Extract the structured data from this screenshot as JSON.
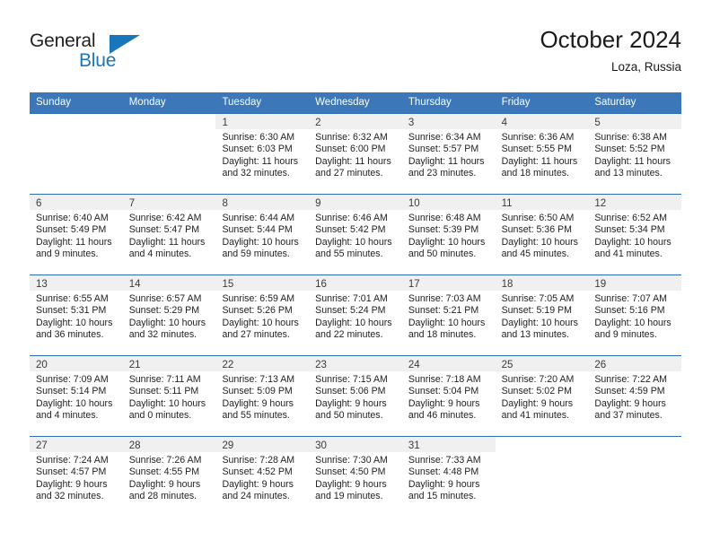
{
  "brand": {
    "name_top": "General",
    "name_bottom": "Blue",
    "accent_color": "#1b75bb",
    "mark": "triangle-icon"
  },
  "header": {
    "title": "October 2024",
    "subtitle": "Loza, Russia"
  },
  "theme": {
    "header_blue": "#3b77b9",
    "row_border_blue": "#2f6daf",
    "daynum_strip": "#f0f0f0"
  },
  "calendar": {
    "weekdays": [
      "Sunday",
      "Monday",
      "Tuesday",
      "Wednesday",
      "Thursday",
      "Friday",
      "Saturday"
    ],
    "weeks": [
      [
        {
          "day": "",
          "sunrise": "",
          "sunset": "",
          "daylight_1": "",
          "daylight_2": ""
        },
        {
          "day": "",
          "sunrise": "",
          "sunset": "",
          "daylight_1": "",
          "daylight_2": ""
        },
        {
          "day": "1",
          "sunrise": "Sunrise: 6:30 AM",
          "sunset": "Sunset: 6:03 PM",
          "daylight_1": "Daylight: 11 hours",
          "daylight_2": "and 32 minutes."
        },
        {
          "day": "2",
          "sunrise": "Sunrise: 6:32 AM",
          "sunset": "Sunset: 6:00 PM",
          "daylight_1": "Daylight: 11 hours",
          "daylight_2": "and 27 minutes."
        },
        {
          "day": "3",
          "sunrise": "Sunrise: 6:34 AM",
          "sunset": "Sunset: 5:57 PM",
          "daylight_1": "Daylight: 11 hours",
          "daylight_2": "and 23 minutes."
        },
        {
          "day": "4",
          "sunrise": "Sunrise: 6:36 AM",
          "sunset": "Sunset: 5:55 PM",
          "daylight_1": "Daylight: 11 hours",
          "daylight_2": "and 18 minutes."
        },
        {
          "day": "5",
          "sunrise": "Sunrise: 6:38 AM",
          "sunset": "Sunset: 5:52 PM",
          "daylight_1": "Daylight: 11 hours",
          "daylight_2": "and 13 minutes."
        }
      ],
      [
        {
          "day": "6",
          "sunrise": "Sunrise: 6:40 AM",
          "sunset": "Sunset: 5:49 PM",
          "daylight_1": "Daylight: 11 hours",
          "daylight_2": "and 9 minutes."
        },
        {
          "day": "7",
          "sunrise": "Sunrise: 6:42 AM",
          "sunset": "Sunset: 5:47 PM",
          "daylight_1": "Daylight: 11 hours",
          "daylight_2": "and 4 minutes."
        },
        {
          "day": "8",
          "sunrise": "Sunrise: 6:44 AM",
          "sunset": "Sunset: 5:44 PM",
          "daylight_1": "Daylight: 10 hours",
          "daylight_2": "and 59 minutes."
        },
        {
          "day": "9",
          "sunrise": "Sunrise: 6:46 AM",
          "sunset": "Sunset: 5:42 PM",
          "daylight_1": "Daylight: 10 hours",
          "daylight_2": "and 55 minutes."
        },
        {
          "day": "10",
          "sunrise": "Sunrise: 6:48 AM",
          "sunset": "Sunset: 5:39 PM",
          "daylight_1": "Daylight: 10 hours",
          "daylight_2": "and 50 minutes."
        },
        {
          "day": "11",
          "sunrise": "Sunrise: 6:50 AM",
          "sunset": "Sunset: 5:36 PM",
          "daylight_1": "Daylight: 10 hours",
          "daylight_2": "and 45 minutes."
        },
        {
          "day": "12",
          "sunrise": "Sunrise: 6:52 AM",
          "sunset": "Sunset: 5:34 PM",
          "daylight_1": "Daylight: 10 hours",
          "daylight_2": "and 41 minutes."
        }
      ],
      [
        {
          "day": "13",
          "sunrise": "Sunrise: 6:55 AM",
          "sunset": "Sunset: 5:31 PM",
          "daylight_1": "Daylight: 10 hours",
          "daylight_2": "and 36 minutes."
        },
        {
          "day": "14",
          "sunrise": "Sunrise: 6:57 AM",
          "sunset": "Sunset: 5:29 PM",
          "daylight_1": "Daylight: 10 hours",
          "daylight_2": "and 32 minutes."
        },
        {
          "day": "15",
          "sunrise": "Sunrise: 6:59 AM",
          "sunset": "Sunset: 5:26 PM",
          "daylight_1": "Daylight: 10 hours",
          "daylight_2": "and 27 minutes."
        },
        {
          "day": "16",
          "sunrise": "Sunrise: 7:01 AM",
          "sunset": "Sunset: 5:24 PM",
          "daylight_1": "Daylight: 10 hours",
          "daylight_2": "and 22 minutes."
        },
        {
          "day": "17",
          "sunrise": "Sunrise: 7:03 AM",
          "sunset": "Sunset: 5:21 PM",
          "daylight_1": "Daylight: 10 hours",
          "daylight_2": "and 18 minutes."
        },
        {
          "day": "18",
          "sunrise": "Sunrise: 7:05 AM",
          "sunset": "Sunset: 5:19 PM",
          "daylight_1": "Daylight: 10 hours",
          "daylight_2": "and 13 minutes."
        },
        {
          "day": "19",
          "sunrise": "Sunrise: 7:07 AM",
          "sunset": "Sunset: 5:16 PM",
          "daylight_1": "Daylight: 10 hours",
          "daylight_2": "and 9 minutes."
        }
      ],
      [
        {
          "day": "20",
          "sunrise": "Sunrise: 7:09 AM",
          "sunset": "Sunset: 5:14 PM",
          "daylight_1": "Daylight: 10 hours",
          "daylight_2": "and 4 minutes."
        },
        {
          "day": "21",
          "sunrise": "Sunrise: 7:11 AM",
          "sunset": "Sunset: 5:11 PM",
          "daylight_1": "Daylight: 10 hours",
          "daylight_2": "and 0 minutes."
        },
        {
          "day": "22",
          "sunrise": "Sunrise: 7:13 AM",
          "sunset": "Sunset: 5:09 PM",
          "daylight_1": "Daylight: 9 hours",
          "daylight_2": "and 55 minutes."
        },
        {
          "day": "23",
          "sunrise": "Sunrise: 7:15 AM",
          "sunset": "Sunset: 5:06 PM",
          "daylight_1": "Daylight: 9 hours",
          "daylight_2": "and 50 minutes."
        },
        {
          "day": "24",
          "sunrise": "Sunrise: 7:18 AM",
          "sunset": "Sunset: 5:04 PM",
          "daylight_1": "Daylight: 9 hours",
          "daylight_2": "and 46 minutes."
        },
        {
          "day": "25",
          "sunrise": "Sunrise: 7:20 AM",
          "sunset": "Sunset: 5:02 PM",
          "daylight_1": "Daylight: 9 hours",
          "daylight_2": "and 41 minutes."
        },
        {
          "day": "26",
          "sunrise": "Sunrise: 7:22 AM",
          "sunset": "Sunset: 4:59 PM",
          "daylight_1": "Daylight: 9 hours",
          "daylight_2": "and 37 minutes."
        }
      ],
      [
        {
          "day": "27",
          "sunrise": "Sunrise: 7:24 AM",
          "sunset": "Sunset: 4:57 PM",
          "daylight_1": "Daylight: 9 hours",
          "daylight_2": "and 32 minutes."
        },
        {
          "day": "28",
          "sunrise": "Sunrise: 7:26 AM",
          "sunset": "Sunset: 4:55 PM",
          "daylight_1": "Daylight: 9 hours",
          "daylight_2": "and 28 minutes."
        },
        {
          "day": "29",
          "sunrise": "Sunrise: 7:28 AM",
          "sunset": "Sunset: 4:52 PM",
          "daylight_1": "Daylight: 9 hours",
          "daylight_2": "and 24 minutes."
        },
        {
          "day": "30",
          "sunrise": "Sunrise: 7:30 AM",
          "sunset": "Sunset: 4:50 PM",
          "daylight_1": "Daylight: 9 hours",
          "daylight_2": "and 19 minutes."
        },
        {
          "day": "31",
          "sunrise": "Sunrise: 7:33 AM",
          "sunset": "Sunset: 4:48 PM",
          "daylight_1": "Daylight: 9 hours",
          "daylight_2": "and 15 minutes."
        },
        {
          "day": "",
          "sunrise": "",
          "sunset": "",
          "daylight_1": "",
          "daylight_2": ""
        },
        {
          "day": "",
          "sunrise": "",
          "sunset": "",
          "daylight_1": "",
          "daylight_2": ""
        }
      ]
    ]
  }
}
